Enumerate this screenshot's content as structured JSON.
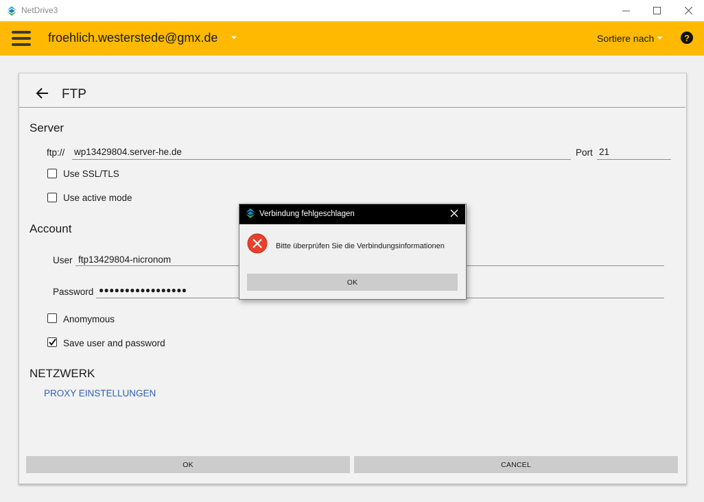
{
  "window": {
    "title": "NetDrive3"
  },
  "header": {
    "account": "froehlich.westerstede@gmx.de",
    "sort_label": "Sortiere nach",
    "help_glyph": "?"
  },
  "page": {
    "title": "FTP"
  },
  "server": {
    "section_title": "Server",
    "prefix": "ftp://",
    "host": "wp13429804.server-he.de",
    "port_label": "Port",
    "port": "21",
    "ssl_label": "Use SSL/TLS",
    "ssl_checked": false,
    "active_label": "Use active mode",
    "active_checked": false
  },
  "account": {
    "section_title": "Account",
    "user_label": "User",
    "user": "ftp13429804-nicronom",
    "password_label": "Password",
    "password_masked": "●●●●●●●●●●●●●●●●●",
    "anonymous_label": "Anomymous",
    "anonymous_checked": false,
    "save_label": "Save user and password",
    "save_checked": true
  },
  "network": {
    "section_title": "NETZWERK",
    "proxy_link": "PROXY EINSTELLUNGEN"
  },
  "buttons": {
    "ok": "OK",
    "cancel": "CANCEL"
  },
  "dialog": {
    "title": "Verbindung fehlgeschlagen",
    "message": "Bitte überprüfen Sie die Verbindungsinformationen",
    "ok": "OK"
  },
  "icons": {
    "app": "netdrive-logo-icon",
    "back": "arrow-left-icon",
    "error": "error-circle-icon",
    "help": "help-circle-icon",
    "menu": "hamburger-menu-icon"
  },
  "colors": {
    "accent": "#FFB901",
    "link": "#2f5fb3",
    "error": "#e8402a"
  }
}
